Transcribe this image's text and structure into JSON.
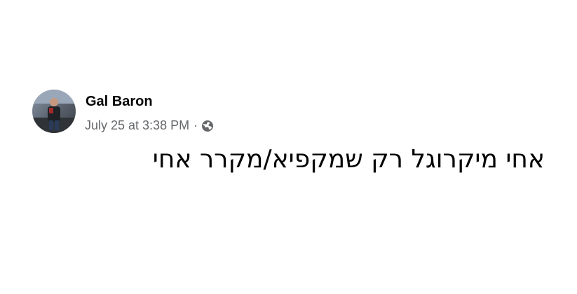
{
  "post": {
    "author": {
      "name": "Gal Baron",
      "avatar_icon": "profile-photo"
    },
    "meta": {
      "timestamp": "July 25 at 3:38 PM",
      "separator": "·",
      "audience_icon": "globe-icon"
    },
    "message": "אחי מיקרוגל רק שמקפיא/מקרר אחי"
  },
  "colors": {
    "text_primary": "#050505",
    "text_secondary": "#65676b",
    "background": "#ffffff"
  }
}
